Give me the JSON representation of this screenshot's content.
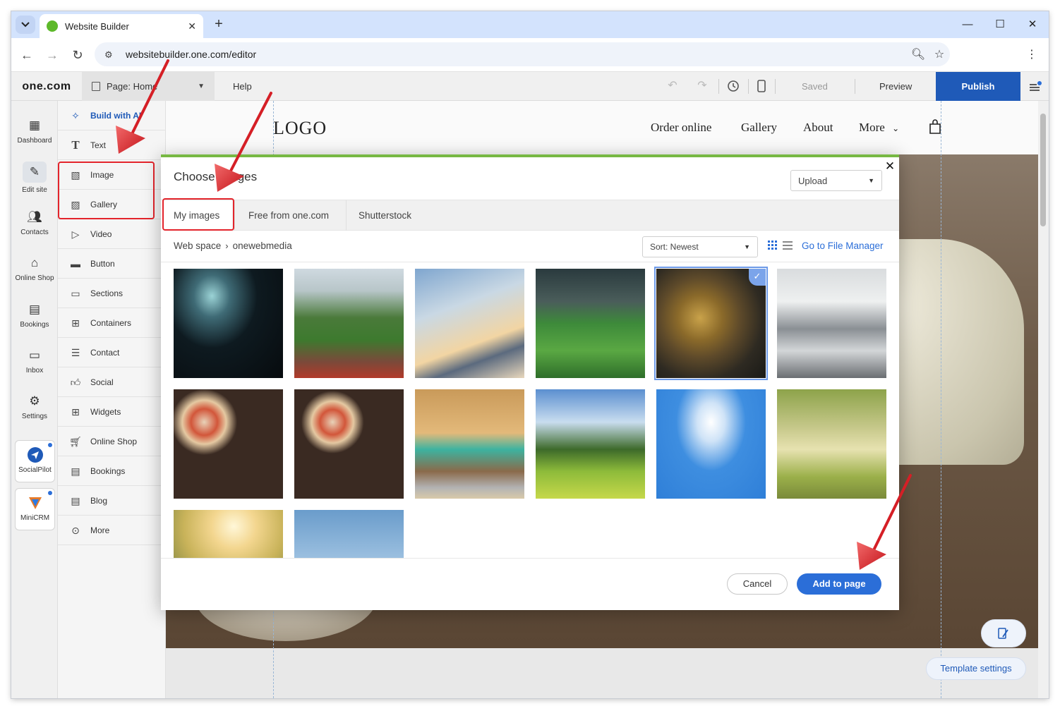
{
  "browser": {
    "tab_title": "Website Builder",
    "url": "websitebuilder.one.com/editor"
  },
  "toolbar": {
    "brand": "one.com",
    "page_label": "Page: Home",
    "help": "Help",
    "saved": "Saved",
    "preview": "Preview",
    "publish": "Publish"
  },
  "leftnav": {
    "items": [
      {
        "label": "Dashboard",
        "icon": "dashboard-icon"
      },
      {
        "label": "Edit site",
        "icon": "edit-site-icon"
      },
      {
        "label": "Contacts",
        "icon": "contacts-icon"
      },
      {
        "label": "Online Shop",
        "icon": "shop-icon"
      },
      {
        "label": "Bookings",
        "icon": "calendar-icon"
      },
      {
        "label": "Inbox",
        "icon": "inbox-icon"
      },
      {
        "label": "Settings",
        "icon": "gear-icon"
      }
    ],
    "apps": [
      {
        "label": "SocialPilot",
        "icon": "socialpilot-icon"
      },
      {
        "label": "MiniCRM",
        "icon": "minicrm-icon"
      }
    ]
  },
  "panel": {
    "items": [
      {
        "label": "Build with AI",
        "icon": "sparkle-icon"
      },
      {
        "label": "Text",
        "icon": "text-icon"
      },
      {
        "label": "Image",
        "icon": "image-icon"
      },
      {
        "label": "Gallery",
        "icon": "gallery-icon"
      },
      {
        "label": "Video",
        "icon": "video-icon"
      },
      {
        "label": "Button",
        "icon": "button-icon"
      },
      {
        "label": "Sections",
        "icon": "sections-icon"
      },
      {
        "label": "Containers",
        "icon": "containers-icon"
      },
      {
        "label": "Contact",
        "icon": "contact-form-icon"
      },
      {
        "label": "Social",
        "icon": "thumbs-up-icon"
      },
      {
        "label": "Widgets",
        "icon": "widgets-icon"
      },
      {
        "label": "Online Shop",
        "icon": "cart-icon"
      },
      {
        "label": "Bookings",
        "icon": "calendar-icon"
      },
      {
        "label": "Blog",
        "icon": "blog-icon"
      },
      {
        "label": "More",
        "icon": "more-icon"
      }
    ]
  },
  "site": {
    "logo": "LOGO",
    "nav": [
      "Order online",
      "Gallery",
      "About",
      "More"
    ]
  },
  "modal": {
    "title": "Choose images",
    "upload": "Upload",
    "tabs": [
      "My images",
      "Free from one.com",
      "Shutterstock"
    ],
    "breadcrumb": [
      "Web space",
      "onewebmedia"
    ],
    "sort": "Sort: Newest",
    "file_manager": "Go to File Manager",
    "cancel": "Cancel",
    "add": "Add to page",
    "images": [
      {
        "subject": "stadium-floodlight",
        "selected": false
      },
      {
        "subject": "stadium-crowd",
        "selected": false
      },
      {
        "subject": "airplane-wing-clouds",
        "selected": false
      },
      {
        "subject": "football-pitch",
        "selected": false
      },
      {
        "subject": "ceramic-bowls",
        "selected": true
      },
      {
        "subject": "open-office",
        "selected": false
      },
      {
        "subject": "pizzas-table",
        "selected": false
      },
      {
        "subject": "pizzas-table-2",
        "selected": false
      },
      {
        "subject": "kid-pilot",
        "selected": false
      },
      {
        "subject": "tree-meadow",
        "selected": false
      },
      {
        "subject": "blue-sky-clouds",
        "selected": false
      },
      {
        "subject": "woman-trees",
        "selected": false
      },
      {
        "subject": "sunlit-hair",
        "selected": false
      },
      {
        "subject": "sky-horizon",
        "selected": false
      }
    ]
  },
  "canvas": {
    "template_settings": "Template settings"
  },
  "colors": {
    "accent": "#1f5ab8",
    "link": "#2b6ed8",
    "annotation": "#e3242b",
    "modal_top": "#77b843"
  }
}
